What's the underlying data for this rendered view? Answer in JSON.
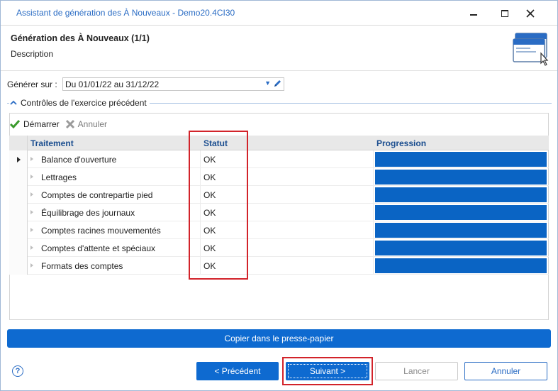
{
  "window": {
    "title": "Assistant de génération des À Nouveaux - Demo20.4CI30"
  },
  "header": {
    "title": "Génération des À Nouveaux (1/1)",
    "description": "Description"
  },
  "form": {
    "generate_label": "Générer sur :",
    "generate_value": "Du 01/01/22 au 31/12/22"
  },
  "group": {
    "title": "Contrôles de l'exercice précédent"
  },
  "toolbar": {
    "start_label": "Démarrer",
    "cancel_label": "Annuler"
  },
  "grid": {
    "columns": {
      "treatment": "Traitement",
      "status": "Statut",
      "progress": "Progression"
    },
    "rows": [
      {
        "name": "Balance d'ouverture",
        "status": "OK",
        "progress": 1.0,
        "selected": true
      },
      {
        "name": "Lettrages",
        "status": "OK",
        "progress": 1.0,
        "selected": false
      },
      {
        "name": "Comptes de contrepartie pied",
        "status": "OK",
        "progress": 1.0,
        "selected": false
      },
      {
        "name": "Équilibrage des journaux",
        "status": "OK",
        "progress": 1.0,
        "selected": false
      },
      {
        "name": "Comptes racines mouvementés",
        "status": "OK",
        "progress": 1.0,
        "selected": false
      },
      {
        "name": "Comptes d'attente et spéciaux",
        "status": "OK",
        "progress": 1.0,
        "selected": false
      },
      {
        "name": "Formats des comptes",
        "status": "OK",
        "progress": 1.0,
        "selected": false
      }
    ]
  },
  "actions": {
    "copy_label": "Copier dans le presse-papier",
    "prev_label": "< Précédent",
    "next_label": "Suivant >",
    "launch_label": "Lancer",
    "cancel_label": "Annuler",
    "help_glyph": "?"
  },
  "colors": {
    "accent": "#0e6ad0",
    "progress_fill": "#0a64c4",
    "highlight_red": "#d2232a",
    "header_text": "#1a4d8f"
  }
}
